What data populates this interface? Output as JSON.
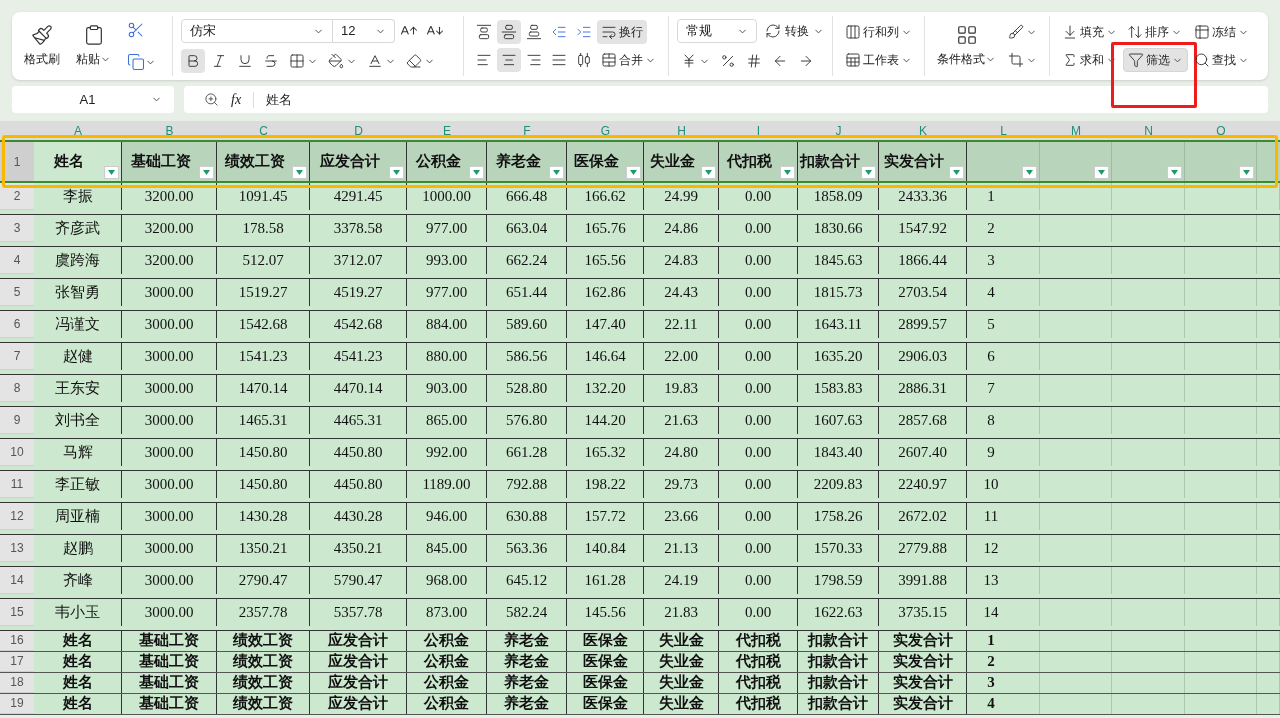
{
  "ribbon": {
    "clipboard": {
      "format_painter": "格式刷",
      "paste": "粘贴"
    },
    "font": {
      "name": "仿宋",
      "size": "12",
      "tools": [
        {
          "kind": "bold",
          "active": true,
          "dropdown": false
        },
        {
          "kind": "italic",
          "active": false,
          "dropdown": false
        },
        {
          "kind": "underline",
          "active": false,
          "dropdown": false
        },
        {
          "kind": "strike",
          "active": false,
          "dropdown": false
        },
        {
          "kind": "border",
          "active": false,
          "dropdown": true
        },
        {
          "kind": "fill",
          "active": false,
          "dropdown": true
        },
        {
          "kind": "fontcolor",
          "active": false,
          "dropdown": true
        },
        {
          "kind": "eraser",
          "active": false,
          "dropdown": true
        }
      ]
    },
    "align_top": [
      {
        "kind": "vtop",
        "active": false
      },
      {
        "kind": "vmiddle",
        "active": true
      },
      {
        "kind": "vbottom",
        "active": false
      },
      {
        "kind": "outdent",
        "active": false
      },
      {
        "kind": "indent",
        "active": false
      },
      {
        "kind": "wrap",
        "label": "换行",
        "active": true,
        "dropdown": false
      }
    ],
    "align_bottom": [
      {
        "kind": "left",
        "active": false
      },
      {
        "kind": "center",
        "active": true
      },
      {
        "kind": "right",
        "active": false
      },
      {
        "kind": "justify",
        "active": false
      },
      {
        "kind": "distribute",
        "active": false
      },
      {
        "kind": "merge",
        "label": "合并",
        "active": false,
        "dropdown": true
      }
    ],
    "number": {
      "format": "常规",
      "convert": "转换",
      "tools": [
        {
          "kind": "yen",
          "dropdown": true
        },
        {
          "kind": "percent",
          "dropdown": false
        },
        {
          "kind": "thousands",
          "dropdown": false
        },
        {
          "kind": "decinc",
          "dropdown": false
        },
        {
          "kind": "decdec",
          "dropdown": false
        }
      ]
    },
    "cells": [
      {
        "kind": "rowscols",
        "label": "行和列",
        "dropdown": true
      },
      {
        "kind": "sheet",
        "label": "工作表",
        "dropdown": true
      }
    ],
    "style": {
      "conditional": "条件格式",
      "tools": [
        {
          "kind": "cellstyle",
          "dropdown": true
        },
        {
          "kind": "crop",
          "dropdown": true
        }
      ]
    },
    "edit": [
      {
        "kind": "fillarrow",
        "label": "填充",
        "active": false,
        "highlighted": false
      },
      {
        "kind": "sort",
        "label": "排序",
        "active": false,
        "highlighted": false
      },
      {
        "kind": "freeze",
        "label": "冻结",
        "active": false,
        "highlighted": false
      },
      {
        "kind": "sum",
        "label": "求和",
        "active": false,
        "highlighted": false
      },
      {
        "kind": "filter",
        "label": "筛选",
        "active": true,
        "highlighted": true
      },
      {
        "kind": "find",
        "label": "查找",
        "active": false,
        "highlighted": false
      }
    ]
  },
  "name_box": "A1",
  "function_label": "fx",
  "formula": "姓名",
  "columns": [
    {
      "letter": "A",
      "filter": true
    },
    {
      "letter": "B",
      "filter": true
    },
    {
      "letter": "C",
      "filter": true
    },
    {
      "letter": "D",
      "filter": true
    },
    {
      "letter": "E",
      "filter": true
    },
    {
      "letter": "F",
      "filter": true
    },
    {
      "letter": "G",
      "filter": true
    },
    {
      "letter": "H",
      "filter": true
    },
    {
      "letter": "I",
      "filter": true
    },
    {
      "letter": "J",
      "filter": true
    },
    {
      "letter": "K",
      "filter": true
    },
    {
      "letter": "L",
      "filter": true
    },
    {
      "letter": "M",
      "filter": true
    },
    {
      "letter": "N",
      "filter": true
    },
    {
      "letter": "O",
      "filter": true
    }
  ],
  "header_row": {
    "row": "1",
    "highlighted": true,
    "cells": [
      {
        "text": "姓名",
        "selected": true
      },
      {
        "text": "基础工资",
        "selected": false
      },
      {
        "text": "绩效工资",
        "selected": false
      },
      {
        "text": "应发合计",
        "selected": false
      },
      {
        "text": "公积金",
        "selected": false
      },
      {
        "text": "养老金",
        "selected": false
      },
      {
        "text": "医保金",
        "selected": false
      },
      {
        "text": "失业金",
        "selected": false
      },
      {
        "text": "代扣税",
        "selected": false
      },
      {
        "text": "扣款合计",
        "selected": false
      },
      {
        "text": "实发合计",
        "selected": false
      }
    ]
  },
  "rows": [
    {
      "row": "2",
      "kind": "data",
      "cells": [
        "李振",
        "3200.00",
        "1091.45",
        "4291.45",
        "1000.00",
        "666.48",
        "166.62",
        "24.99",
        "0.00",
        "1858.09",
        "2433.36",
        "1"
      ]
    },
    {
      "row": "3",
      "kind": "data",
      "cells": [
        "齐彦武",
        "3200.00",
        "178.58",
        "3378.58",
        "977.00",
        "663.04",
        "165.76",
        "24.86",
        "0.00",
        "1830.66",
        "1547.92",
        "2"
      ]
    },
    {
      "row": "4",
      "kind": "data",
      "cells": [
        "虞跨海",
        "3200.00",
        "512.07",
        "3712.07",
        "993.00",
        "662.24",
        "165.56",
        "24.83",
        "0.00",
        "1845.63",
        "1866.44",
        "3"
      ]
    },
    {
      "row": "5",
      "kind": "data",
      "cells": [
        "张智勇",
        "3000.00",
        "1519.27",
        "4519.27",
        "977.00",
        "651.44",
        "162.86",
        "24.43",
        "0.00",
        "1815.73",
        "2703.54",
        "4"
      ]
    },
    {
      "row": "6",
      "kind": "data",
      "cells": [
        "冯谨文",
        "3000.00",
        "1542.68",
        "4542.68",
        "884.00",
        "589.60",
        "147.40",
        "22.11",
        "0.00",
        "1643.11",
        "2899.57",
        "5"
      ]
    },
    {
      "row": "7",
      "kind": "data",
      "cells": [
        "赵健",
        "3000.00",
        "1541.23",
        "4541.23",
        "880.00",
        "586.56",
        "146.64",
        "22.00",
        "0.00",
        "1635.20",
        "2906.03",
        "6"
      ]
    },
    {
      "row": "8",
      "kind": "data",
      "cells": [
        "王东安",
        "3000.00",
        "1470.14",
        "4470.14",
        "903.00",
        "528.80",
        "132.20",
        "19.83",
        "0.00",
        "1583.83",
        "2886.31",
        "7"
      ]
    },
    {
      "row": "9",
      "kind": "data",
      "cells": [
        "刘书全",
        "3000.00",
        "1465.31",
        "4465.31",
        "865.00",
        "576.80",
        "144.20",
        "21.63",
        "0.00",
        "1607.63",
        "2857.68",
        "8"
      ]
    },
    {
      "row": "10",
      "kind": "data",
      "cells": [
        "马辉",
        "3000.00",
        "1450.80",
        "4450.80",
        "992.00",
        "661.28",
        "165.32",
        "24.80",
        "0.00",
        "1843.40",
        "2607.40",
        "9"
      ]
    },
    {
      "row": "11",
      "kind": "data",
      "cells": [
        "李正敏",
        "3000.00",
        "1450.80",
        "4450.80",
        "1189.00",
        "792.88",
        "198.22",
        "29.73",
        "0.00",
        "2209.83",
        "2240.97",
        "10"
      ]
    },
    {
      "row": "12",
      "kind": "data",
      "cells": [
        "周亚楠",
        "3000.00",
        "1430.28",
        "4430.28",
        "946.00",
        "630.88",
        "157.72",
        "23.66",
        "0.00",
        "1758.26",
        "2672.02",
        "11"
      ]
    },
    {
      "row": "13",
      "kind": "data",
      "cells": [
        "赵鹏",
        "3000.00",
        "1350.21",
        "4350.21",
        "845.00",
        "563.36",
        "140.84",
        "21.13",
        "0.00",
        "1570.33",
        "2779.88",
        "12"
      ]
    },
    {
      "row": "14",
      "kind": "data",
      "cells": [
        "齐峰",
        "3000.00",
        "2790.47",
        "5790.47",
        "968.00",
        "645.12",
        "161.28",
        "24.19",
        "0.00",
        "1798.59",
        "3991.88",
        "13"
      ]
    },
    {
      "row": "15",
      "kind": "data",
      "cells": [
        "韦小玉",
        "3000.00",
        "2357.78",
        "5357.78",
        "873.00",
        "582.24",
        "145.56",
        "21.83",
        "0.00",
        "1622.63",
        "3735.15",
        "14"
      ]
    },
    {
      "row": "16",
      "kind": "title",
      "cells": [
        "姓名",
        "基础工资",
        "绩效工资",
        "应发合计",
        "公积金",
        "养老金",
        "医保金",
        "失业金",
        "代扣税",
        "扣款合计",
        "实发合计",
        "1"
      ]
    },
    {
      "row": "17",
      "kind": "title",
      "cells": [
        "姓名",
        "基础工资",
        "绩效工资",
        "应发合计",
        "公积金",
        "养老金",
        "医保金",
        "失业金",
        "代扣税",
        "扣款合计",
        "实发合计",
        "2"
      ]
    },
    {
      "row": "18",
      "kind": "title",
      "cells": [
        "姓名",
        "基础工资",
        "绩效工资",
        "应发合计",
        "公积金",
        "养老金",
        "医保金",
        "失业金",
        "代扣税",
        "扣款合计",
        "实发合计",
        "3"
      ]
    },
    {
      "row": "19",
      "kind": "title",
      "cells": [
        "姓名",
        "基础工资",
        "绩效工资",
        "应发合计",
        "公积金",
        "养老金",
        "医保金",
        "失业金",
        "代扣税",
        "扣款合计",
        "实发合计",
        "4"
      ]
    }
  ]
}
